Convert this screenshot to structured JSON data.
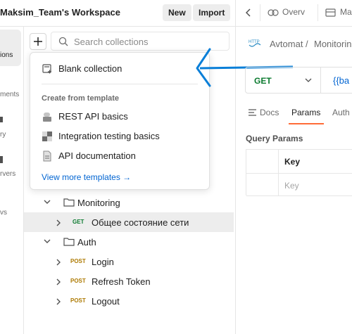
{
  "header": {
    "workspace_title": "Maksim_Team's Workspace",
    "new_label": "New",
    "import_label": "Import",
    "tabs": [
      {
        "label": "Overv"
      },
      {
        "label": "Ma"
      }
    ]
  },
  "rail": {
    "items": [
      {
        "label": "ions"
      },
      {
        "label": "ments"
      },
      {
        "label": "ry"
      },
      {
        "label": "rvers"
      },
      {
        "label": "vs"
      }
    ]
  },
  "sidebar": {
    "search_placeholder": "Search collections",
    "tree": [
      {
        "type": "folder",
        "label": "Monitoring"
      },
      {
        "type": "request",
        "method": "GET",
        "label": "Общее состояние сети"
      },
      {
        "type": "folder",
        "label": "Auth"
      },
      {
        "type": "request",
        "method": "POST",
        "label": "Login"
      },
      {
        "type": "request",
        "method": "POST",
        "label": "Refresh Token"
      },
      {
        "type": "request",
        "method": "POST",
        "label": "Logout"
      }
    ]
  },
  "popover": {
    "blank_label": "Blank collection",
    "section_title": "Create from template",
    "templates": [
      {
        "label": "REST API basics"
      },
      {
        "label": "Integration testing basics"
      },
      {
        "label": "API documentation"
      }
    ],
    "more_link": "View more templates →"
  },
  "request": {
    "breadcrumb_root": "Avtomat",
    "breadcrumb_sep": "/",
    "breadcrumb_child": "Monitorin",
    "method": "GET",
    "url": "{{ba",
    "subtabs": [
      {
        "label": "Docs"
      },
      {
        "label": "Params"
      },
      {
        "label": "Auth"
      }
    ],
    "query_params_title": "Query Params",
    "table_header_key": "Key",
    "table_placeholder_key": "Key"
  },
  "colors": {
    "accent": "#ff6c37",
    "arrow": "#0a7fd8",
    "get": "#0b7a2f",
    "post": "#ad7a03",
    "link": "#0265d2"
  }
}
